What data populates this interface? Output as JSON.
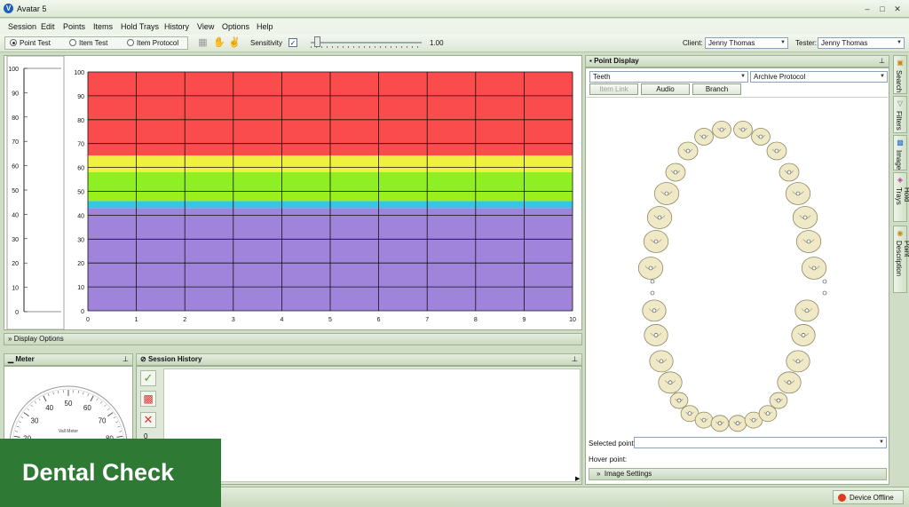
{
  "window": {
    "title": "Avatar 5",
    "controls": [
      "–",
      "□",
      "✕"
    ]
  },
  "menu": [
    "Session",
    "Edit",
    "Points",
    "Items",
    "Hold Trays",
    "History",
    "View",
    "Options",
    "Help"
  ],
  "toolbar": {
    "modes": [
      "Point Test",
      "Item Test",
      "Item Protocol"
    ],
    "selected_mode": "Point Test",
    "sensitivity_label": "Sensitivity",
    "sensitivity_checked": true,
    "sensitivity_value": "1.00",
    "sensitivity_level": 0.05,
    "client_label": "Client:",
    "client_value": "Jenny Thomas",
    "tester_label": "Tester:",
    "tester_value": "Jenny Thomas",
    "icons": [
      "grid-icon",
      "hands-icon",
      "hands-alt-icon"
    ]
  },
  "chart_data": {
    "type": "heatmap",
    "x_ticks": [
      "0",
      "1",
      "2",
      "3",
      "4",
      "5",
      "6",
      "7",
      "8",
      "9",
      "10"
    ],
    "y_ticks": [
      "0",
      "10",
      "20",
      "30",
      "40",
      "50",
      "60",
      "70",
      "80",
      "90",
      "100"
    ],
    "xlim": [
      0,
      10
    ],
    "ylim": [
      0,
      100
    ],
    "grid": true,
    "bands": [
      {
        "from": 0,
        "to": 43,
        "color": "#a084dc"
      },
      {
        "from": 43,
        "to": 46,
        "color": "#33c6e8"
      },
      {
        "from": 46,
        "to": 50,
        "color": "#9af01a"
      },
      {
        "from": 50,
        "to": 58,
        "color": "#8ef022"
      },
      {
        "from": 58,
        "to": 65,
        "color": "#f0f040"
      },
      {
        "from": 65,
        "to": 100,
        "color": "#fa4c4c"
      }
    ],
    "side_scale_ticks": [
      "0",
      "10",
      "20",
      "30",
      "40",
      "50",
      "60",
      "70",
      "80",
      "90",
      "100"
    ]
  },
  "display_options": {
    "label": "Display Options"
  },
  "meter": {
    "title": "Meter",
    "dial_ticks": [
      "10",
      "20",
      "30",
      "40",
      "50",
      "60",
      "70",
      "80",
      "90"
    ],
    "dial_label": "Vall Meter"
  },
  "session_history": {
    "title": "Session History",
    "count": "0"
  },
  "point_display": {
    "title": "Point Display",
    "category": "Teeth",
    "protocol": "Archive Protocol",
    "buttons": {
      "item_link": "Item Link",
      "audio": "Audio",
      "branch": "Branch"
    },
    "selected_point_label": "Selected point:",
    "hover_point_label": "Hover point:",
    "image_settings_label": "Image Settings"
  },
  "side_tabs": [
    {
      "label": "Search",
      "icon": "search-icon"
    },
    {
      "label": "Filters",
      "icon": "filter-icon"
    },
    {
      "label": "Image",
      "icon": "image-icon"
    },
    {
      "label": "Hold Trays",
      "icon": "tray-icon"
    },
    {
      "label": "Point Description",
      "icon": "info-icon"
    }
  ],
  "status": {
    "device": "Device Offline",
    "device_color": "#e03a1e"
  },
  "overlay_caption": "Dental Check"
}
